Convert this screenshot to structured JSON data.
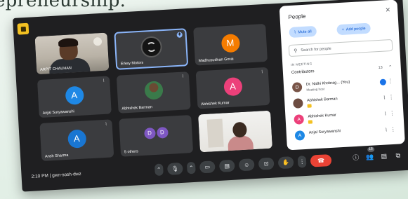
{
  "backdrop_text": "epreneurship.",
  "meeting": {
    "time": "2:10 PM",
    "separator": "|",
    "code": "gwn-sosh-dwz"
  },
  "tiles": [
    {
      "name": "ARPIT CHAUHAN",
      "kind": "photo"
    },
    {
      "name": "Erkey Motors",
      "kind": "logo",
      "pinned": true
    },
    {
      "name": "Madhusudhan Gorai",
      "kind": "avatar",
      "initial": "M",
      "color": "#f57c00"
    },
    {
      "name": "Anjal Suryawanshi",
      "kind": "avatar",
      "initial": "A",
      "color": "#1e88e5"
    },
    {
      "name": "Abhishek Barman",
      "kind": "small-photo"
    },
    {
      "name": "Abhishek Kumar",
      "kind": "avatar",
      "initial": "A",
      "color": "#ec407a"
    },
    {
      "name": "Ansh Sharma",
      "kind": "avatar",
      "initial": "A",
      "color": "#1976d2"
    },
    {
      "name": "5 others",
      "kind": "others",
      "initials": [
        "D",
        "D"
      ]
    },
    {
      "name": "",
      "kind": "room-photo"
    }
  ],
  "controls": {
    "more_left": "⌃",
    "mic": "🎙",
    "more_cam": "⌃",
    "camera": "▭",
    "captions": "▤",
    "emoji": "☺",
    "present": "⊡",
    "raise_hand": "✋",
    "more": "⋮",
    "end_call": "☎"
  },
  "right_controls": {
    "info": "ⓘ",
    "people_count": "18",
    "people": "👥",
    "chat": "▤",
    "activities": "⧉",
    "lock": "🔒"
  },
  "panel": {
    "title": "People",
    "close": "✕",
    "mute_all": "Mute all",
    "add_people": "Add people",
    "search_placeholder": "Search for people",
    "section": "IN MEETING",
    "group": "Contributors",
    "group_count": "13",
    "people": [
      {
        "name": "Dr. Nidhi Khobrag... (You)",
        "sub": "Meeting host",
        "initial": "D",
        "color": "#795548",
        "host": true
      },
      {
        "name": "Abhishek Barman",
        "sub": "",
        "initial": "",
        "color": "#6d4c41",
        "tagged": true
      },
      {
        "name": "Abhishek Kumar",
        "sub": "",
        "initial": "A",
        "color": "#ec407a",
        "tagged": true
      },
      {
        "name": "Anjal Suryawanshi",
        "sub": "",
        "initial": "A",
        "color": "#1e88e5"
      }
    ]
  }
}
